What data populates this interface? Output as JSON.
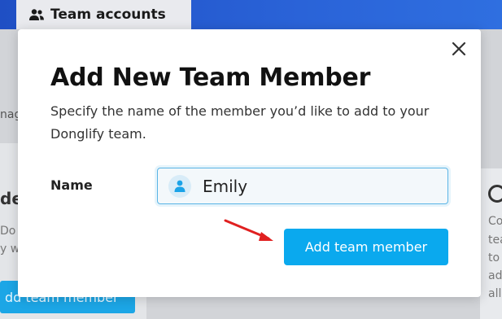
{
  "background": {
    "tab_label": "Team accounts",
    "left_fragment": "nag",
    "left_card_heading": "de",
    "left_card_line1": "Do",
    "left_card_line2": "y w",
    "left_button_label": "dd team member",
    "right_card_lines": [
      "Co",
      "tea",
      "to",
      "ad",
      "all"
    ]
  },
  "modal": {
    "title": "Add New Team Member",
    "description": "Specify the name of the member you’d like to add to your Donglify team.",
    "name_label": "Name",
    "name_value": "Emily",
    "submit_label": "Add team member",
    "close_icon": "close-icon"
  },
  "colors": {
    "header_blue": "#2a63d8",
    "button_blue": "#0aa9ee",
    "arrow_red": "#e02020",
    "input_border": "#5ab4e6"
  }
}
